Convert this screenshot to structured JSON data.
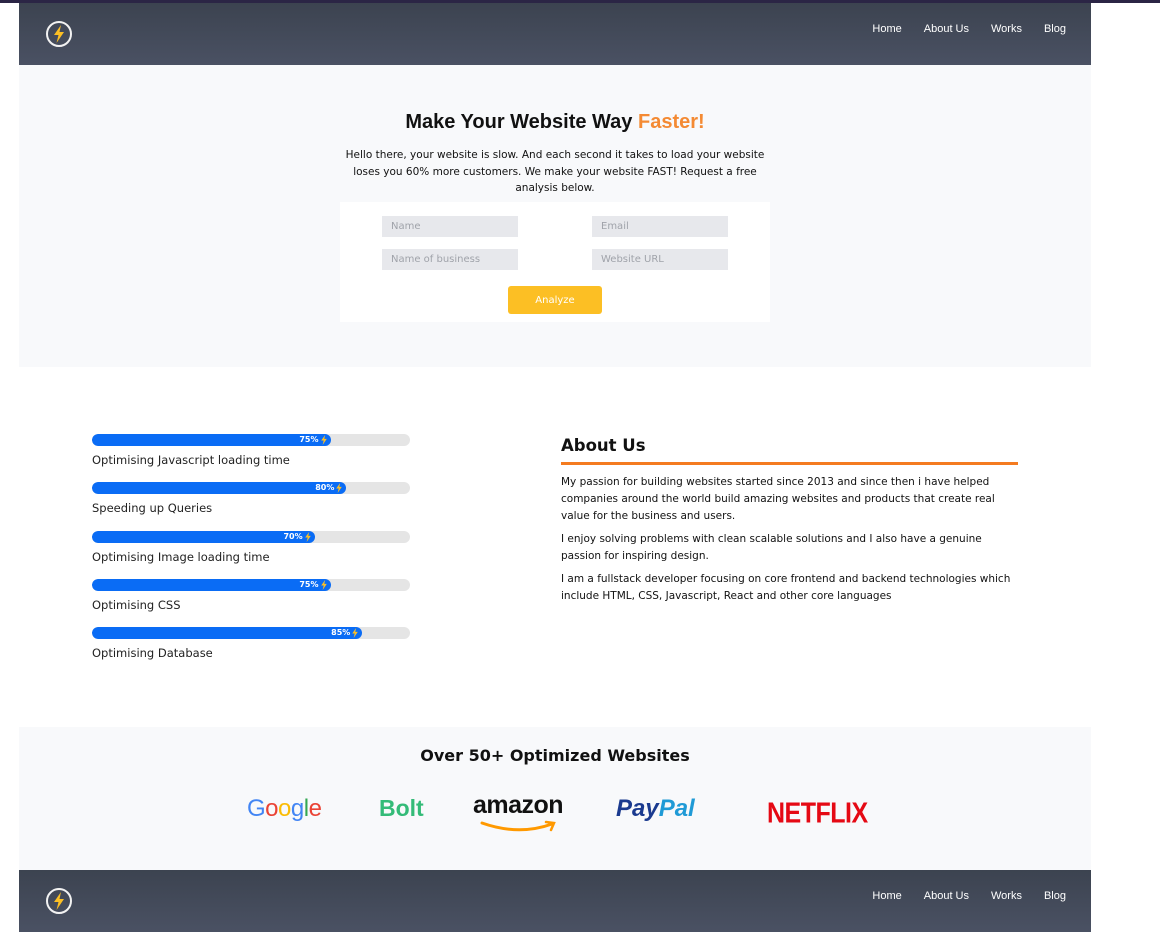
{
  "nav": {
    "logo_icon": "lightning-bolt-icon",
    "links": [
      "Home",
      "About Us",
      "Works",
      "Blog"
    ]
  },
  "hero": {
    "title_main": "Make Your Website Way ",
    "title_accent": "Faster!",
    "subtitle": "Hello there, your website is slow. And each second it takes to load your website loses you 60% more customers. We make your website FAST! Request a free analysis below.",
    "form": {
      "name_placeholder": "Name",
      "email_placeholder": "Email",
      "business_placeholder": "Name of business",
      "url_placeholder": "Website URL",
      "submit_label": "Analyze"
    }
  },
  "skills": [
    {
      "label": "Optimising Javascript loading time",
      "percent": 75,
      "percent_text": "75%"
    },
    {
      "label": "Speeding up Queries",
      "percent": 80,
      "percent_text": "80%"
    },
    {
      "label": "Optimising Image loading time",
      "percent": 70,
      "percent_text": "70%"
    },
    {
      "label": "Optimising CSS",
      "percent": 75,
      "percent_text": "75%"
    },
    {
      "label": "Optimising Database",
      "percent": 85,
      "percent_text": "85%"
    }
  ],
  "about": {
    "title": "About Us",
    "paragraphs": [
      "My passion for building websites started since 2013 and since then i have helped companies around the world build amazing websites and products that create real value for the business and users.",
      "I enjoy solving problems with clean scalable solutions and I also have a genuine passion for inspiring design.",
      "I am a fullstack developer focusing on core frontend and backend technologies which include HTML, CSS, Javascript, React and other core languages"
    ]
  },
  "clients": {
    "title": "Over 50+ Optimized Websites",
    "logos": [
      "Google",
      "Bolt",
      "amazon",
      "PayPal",
      "NETFLIX"
    ]
  },
  "colors": {
    "accent_orange": "#f48a33",
    "bar_blue": "#0a6cf5",
    "button_yellow": "#fcbf24",
    "nav_dark": "#414857"
  }
}
